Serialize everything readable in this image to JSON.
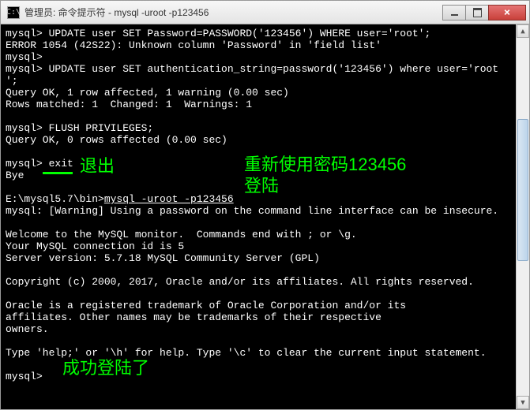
{
  "window": {
    "title": "管理员: 命令提示符 - mysql  -uroot -p123456",
    "icon_glyph": "C:\\"
  },
  "terminal": {
    "lines": [
      "mysql> UPDATE user SET Password=PASSWORD('123456') WHERE user='root';",
      "ERROR 1054 (42S22): Unknown column 'Password' in 'field list'",
      "mysql>",
      "mysql> UPDATE user SET authentication_string=password('123456') where user='root",
      "';",
      "Query OK, 1 row affected, 1 warning (0.00 sec)",
      "Rows matched: 1  Changed: 1  Warnings: 1",
      "",
      "mysql> FLUSH PRIVILEGES;",
      "Query OK, 0 rows affected (0.00 sec)",
      "",
      "mysql> exit",
      "Bye",
      "",
      "E:\\mysql5.7\\bin>",
      "mysql: [Warning] Using a password on the command line interface can be insecure.",
      "",
      "Welcome to the MySQL monitor.  Commands end with ; or \\g.",
      "Your MySQL connection id is 5",
      "Server version: 5.7.18 MySQL Community Server (GPL)",
      "",
      "Copyright (c) 2000, 2017, Oracle and/or its affiliates. All rights reserved.",
      "",
      "Oracle is a registered trademark of Oracle Corporation and/or its",
      "affiliates. Other names may be trademarks of their respective",
      "owners.",
      "",
      "Type 'help;' or '\\h' for help. Type '\\c' to clear the current input statement.",
      "",
      "mysql>"
    ],
    "login_cmd": "mysql -uroot -p123456"
  },
  "annotations": {
    "exit": "退出",
    "relogin_pw": "重新使用密码123456",
    "relogin": "登陆",
    "success": "成功登陆了"
  }
}
